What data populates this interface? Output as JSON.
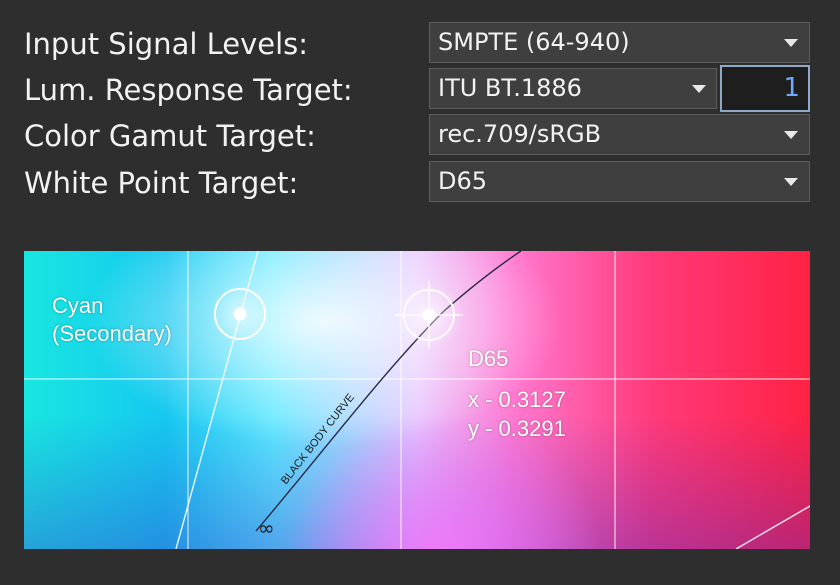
{
  "settings": [
    {
      "label": "Input Signal Levels:",
      "value": "SMPTE (64-940)"
    },
    {
      "label": "Lum. Response Target:",
      "value": "ITU BT.1886",
      "gamma": "1"
    },
    {
      "label": "Color Gamut Target:",
      "value": "rec.709/sRGB"
    },
    {
      "label": "White Point Target:",
      "value": "D65"
    }
  ],
  "chart": {
    "cyan_label_1": "Cyan",
    "cyan_label_2": "(Secondary)",
    "whitepoint_label": "D65",
    "x_value": "x - 0.3127",
    "y_value": "y - 0.3291",
    "curve_label": "BLACK BODY CURVE",
    "infinity": "∞"
  },
  "colors": {
    "background": "#2e2e2e",
    "dropdown": "#3f3f3f",
    "numbox_text": "#6fa8ff"
  }
}
